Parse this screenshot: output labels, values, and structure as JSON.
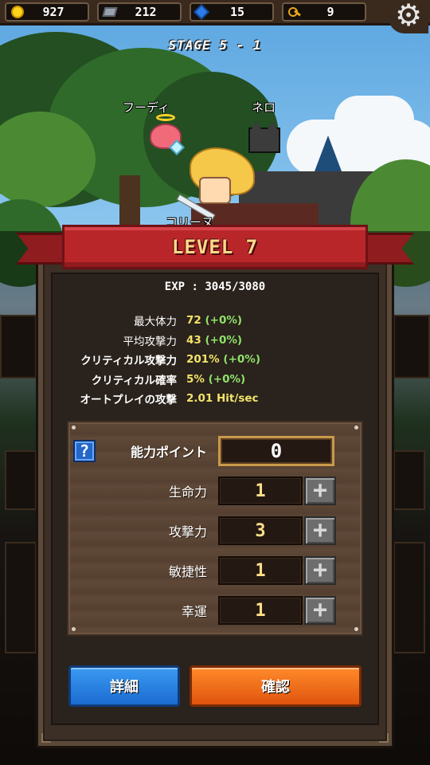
{
  "resources": {
    "gold": "927",
    "iron": "212",
    "gems": "15",
    "keys": "9"
  },
  "stage": "STAGE 5 - 1",
  "characters": {
    "companion_left": "フーディ",
    "companion_right": "ネロ",
    "hero": "コリーヌ"
  },
  "modal": {
    "title": "LEVEL 7",
    "exp": "EXP : 3045/3080",
    "stats": [
      {
        "label": "最大体力",
        "value": "72",
        "delta": "(+0%)"
      },
      {
        "label": "平均攻撃力",
        "value": "43",
        "delta": "(+0%)"
      },
      {
        "label": "クリティカル攻撃力",
        "value": "201%",
        "delta": "(+0%)"
      },
      {
        "label": "クリティカル確率",
        "value": "5%",
        "delta": "(+0%)"
      },
      {
        "label": "オートプレイの攻撃",
        "value": "2.01 Hit/sec",
        "delta": ""
      }
    ],
    "help_label": "?",
    "ability_points": {
      "label": "能力ポイント",
      "value": "0"
    },
    "abilities": [
      {
        "label": "生命力",
        "value": "1"
      },
      {
        "label": "攻撃力",
        "value": "3"
      },
      {
        "label": "敏捷性",
        "value": "1"
      },
      {
        "label": "幸運",
        "value": "1"
      }
    ],
    "plus_symbol": "+",
    "detail_button": "詳細",
    "confirm_button": "確認"
  },
  "colors": {
    "ribbon": "#b9262a",
    "stat_value": "#f2e46a",
    "stat_delta": "#8ee26a",
    "detail_button": "#2a82e4",
    "confirm_button": "#f06a1a"
  }
}
